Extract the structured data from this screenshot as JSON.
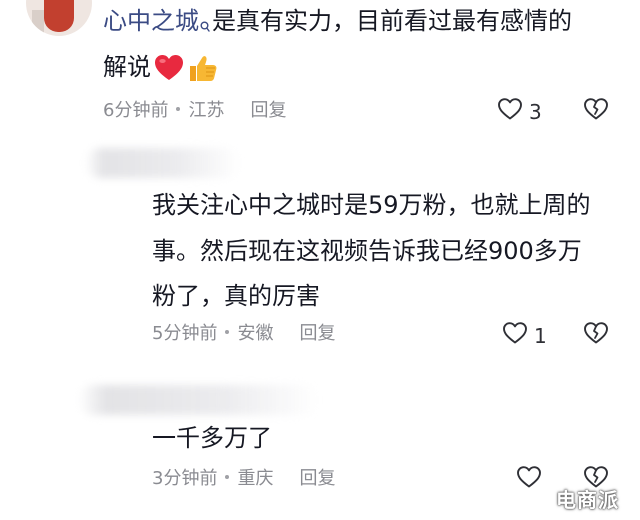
{
  "comments": [
    {
      "author": "心中之城",
      "text_line1": "是真有实力，目前看过最有感情的",
      "text_line2": "解说",
      "time": "6分钟前",
      "location": "江苏",
      "reply_label": "回复",
      "likes": "3"
    },
    {
      "lines": [
        "我关注心中之城时是59万粉，也就上周的",
        "事。然后现在这视频告诉我已经900多万",
        "粉了，真的厉害"
      ],
      "time": "5分钟前",
      "location": "安徽",
      "reply_label": "回复",
      "likes": "1"
    },
    {
      "lines": [
        "一千多万了"
      ],
      "time": "3分钟前",
      "location": "重庆",
      "reply_label": "回复",
      "likes": ""
    }
  ],
  "watermark": "电商派",
  "colors": {
    "author": "#3b4b84",
    "text": "#161823",
    "meta": "#8a8b91",
    "heart_emoji": "#e8293f",
    "thumb_emoji": "#f7b733"
  },
  "icons": {
    "like": "heart-outline-icon",
    "dislike": "broken-heart-icon",
    "search": "search-icon"
  }
}
